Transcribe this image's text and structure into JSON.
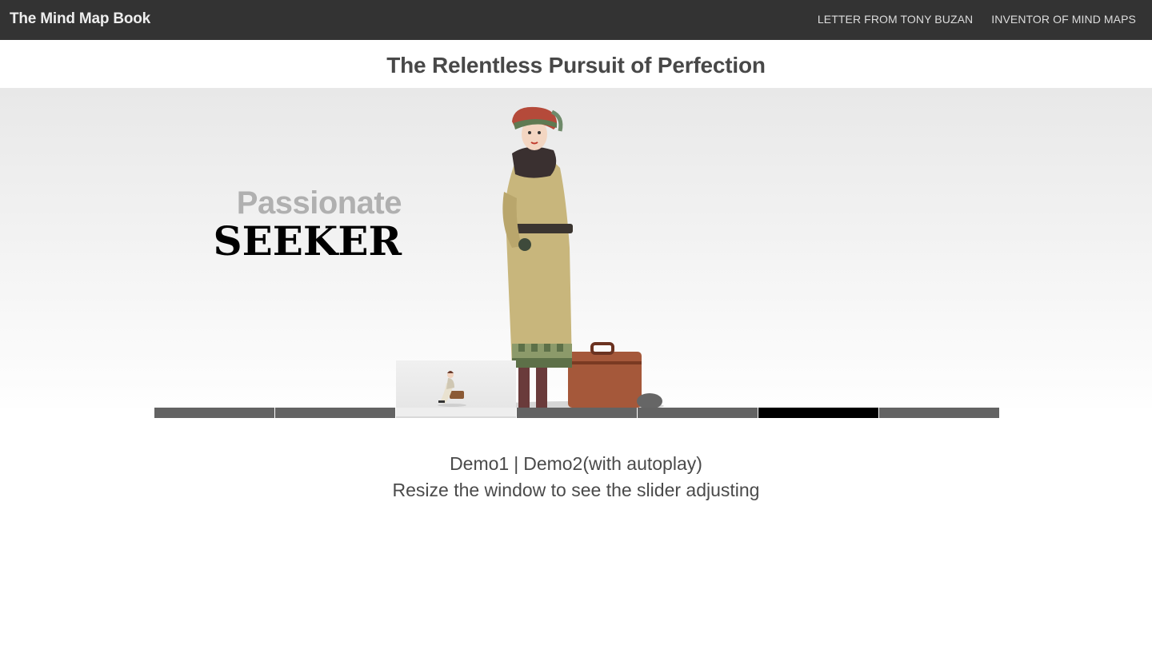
{
  "navbar": {
    "brand": "The Mind Map Book",
    "links": [
      "LETTER FROM TONY BUZAN",
      "INVENTOR OF MIND MAPS"
    ]
  },
  "page_title": "The Relentless Pursuit of Perfection",
  "slide": {
    "caption_line1": "Passionate",
    "caption_line2": "SEEKER",
    "tab_count": 7,
    "hovered_tab": 3,
    "active_tab": 6
  },
  "footer": {
    "demo1": "Demo1",
    "separator": "|",
    "demo2": "Demo2(with autoplay)",
    "note": "Resize the window to see the slider adjusting"
  },
  "colors": {
    "navbar_bg": "#333333",
    "tab_default": "#636363",
    "tab_active": "#000000",
    "tab_hover": "#eeeeee"
  }
}
